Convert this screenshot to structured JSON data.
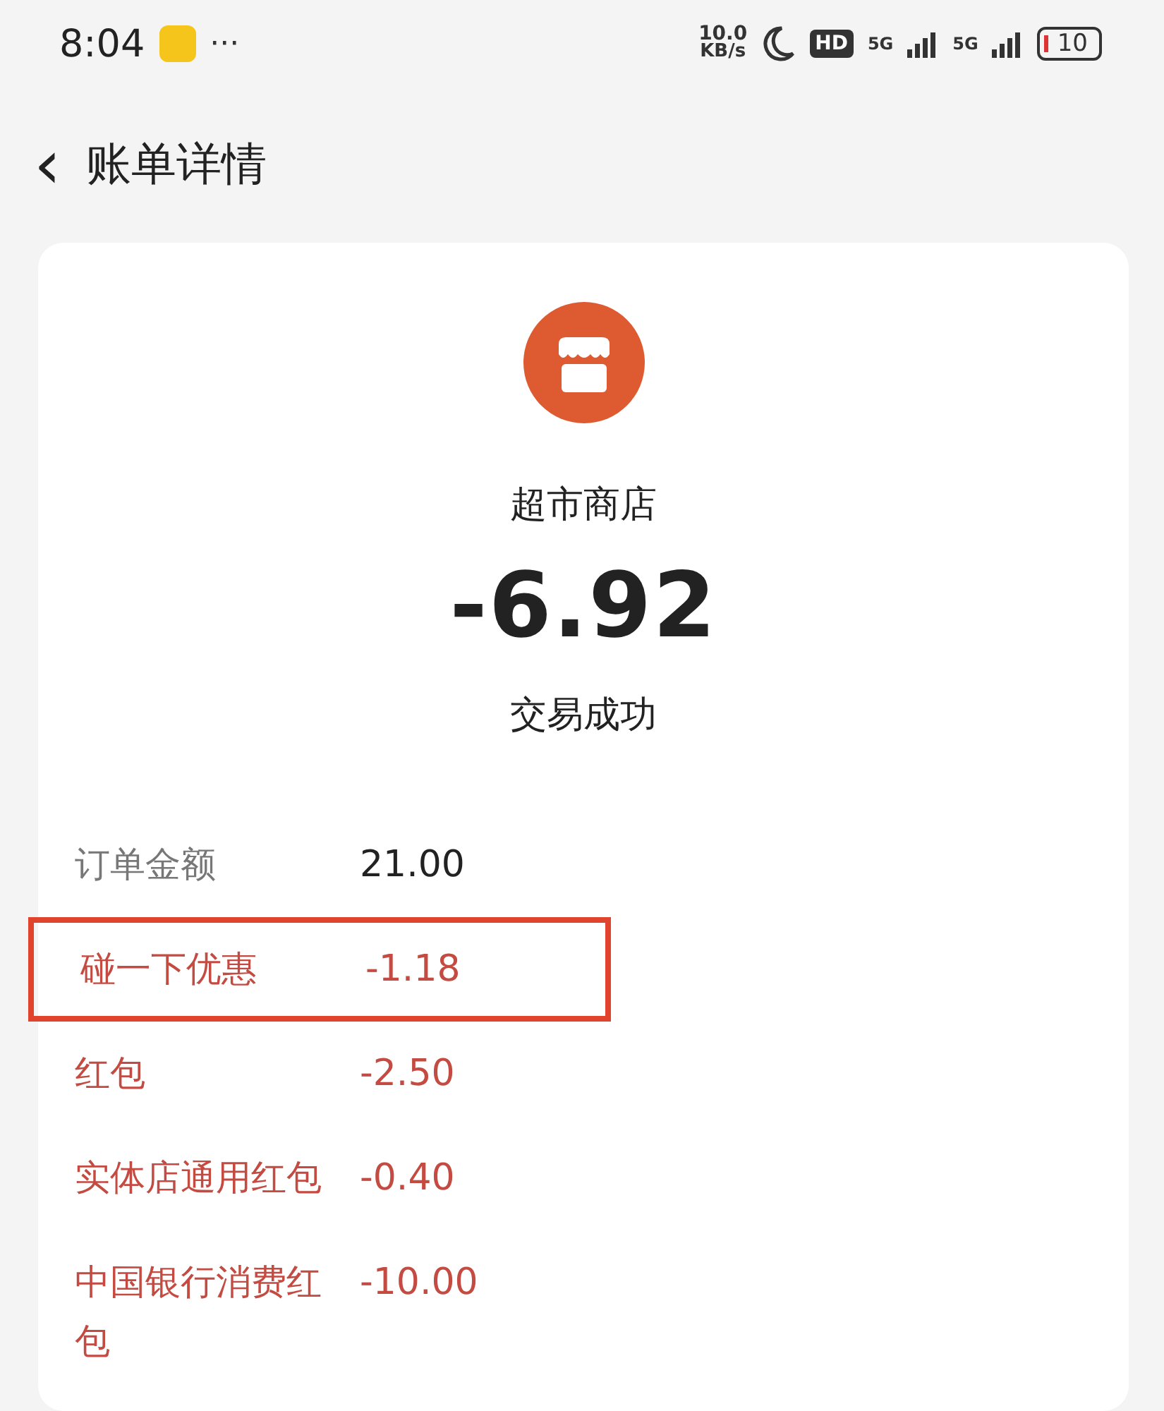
{
  "status_bar": {
    "time": "8:04",
    "more": "···",
    "speed_value": "10.0",
    "speed_unit": "KB/s",
    "hd": "HD",
    "network_1": "5G",
    "network_2": "5G",
    "battery": "10"
  },
  "header": {
    "back": "‹",
    "title": "账单详情"
  },
  "bill": {
    "merchant": "超市商店",
    "amount": "-6.92",
    "status": "交易成功",
    "rows": [
      {
        "kind": "normal",
        "label": "订单金额",
        "value": "21.00",
        "highlighted": false
      },
      {
        "kind": "discount",
        "label": "碰一下优惠",
        "value": "-1.18",
        "highlighted": true
      },
      {
        "kind": "discount",
        "label": "红包",
        "value": "-2.50",
        "highlighted": false
      },
      {
        "kind": "discount",
        "label": "实体店通用红包",
        "value": "-0.40",
        "highlighted": false
      },
      {
        "kind": "discount",
        "label": "中国银行消费红包",
        "value": "-10.00",
        "highlighted": false
      }
    ]
  }
}
